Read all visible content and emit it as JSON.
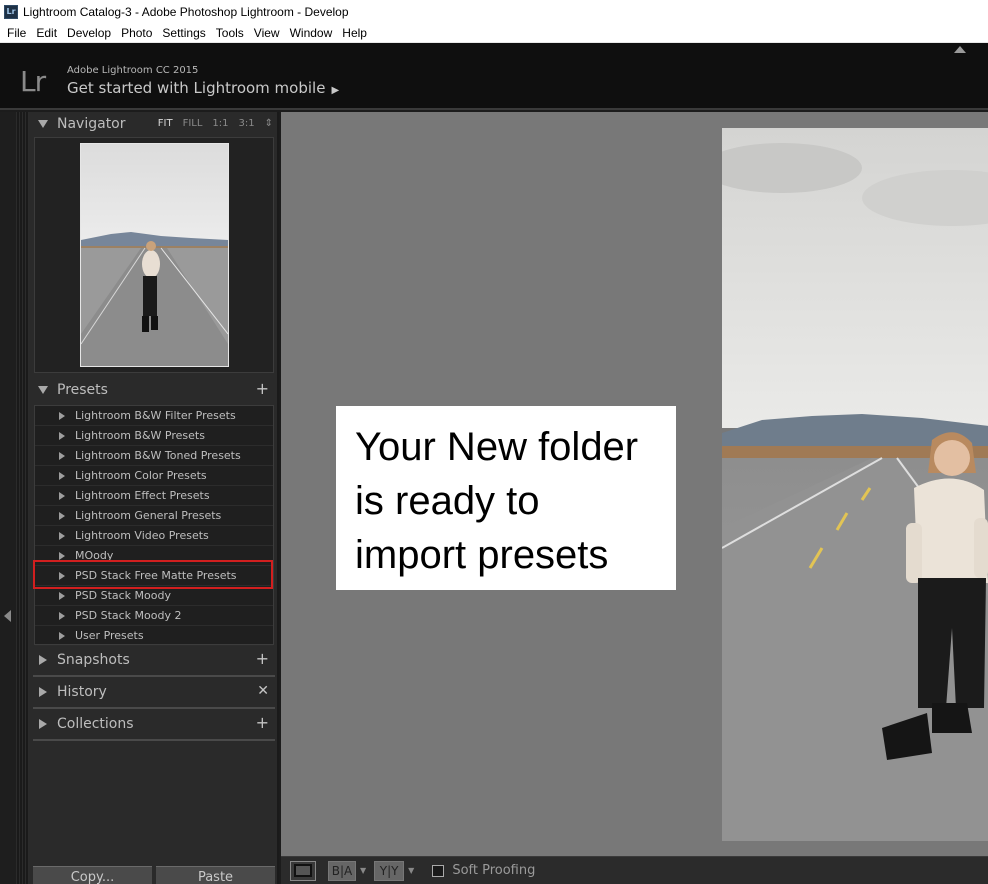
{
  "window": {
    "title": "Lightroom Catalog-3 - Adobe Photoshop Lightroom - Develop",
    "app_icon_text": "Lr"
  },
  "menu": [
    "File",
    "Edit",
    "Develop",
    "Photo",
    "Settings",
    "Tools",
    "View",
    "Window",
    "Help"
  ],
  "identity": {
    "logo": "Lr",
    "product": "Adobe Lightroom CC 2015",
    "cta": "Get started with Lightroom mobile",
    "cta_arrow": "▶"
  },
  "navigator": {
    "title": "Navigator",
    "zoom_options": [
      "FIT",
      "FILL",
      "1:1",
      "3:1"
    ],
    "active_zoom": "FIT"
  },
  "presets": {
    "title": "Presets",
    "items": [
      "Lightroom B&W Filter Presets",
      "Lightroom B&W Presets",
      "Lightroom B&W Toned Presets",
      "Lightroom Color Presets",
      "Lightroom Effect Presets",
      "Lightroom General Presets",
      "Lightroom Video Presets",
      "MOody",
      "PSD Stack Free Matte Presets",
      "PSD Stack Moody",
      "PSD Stack Moody 2",
      "User Presets"
    ],
    "highlighted": "PSD Stack Free Matte Presets"
  },
  "panels": {
    "snapshots": "Snapshots",
    "history": "History",
    "collections": "Collections"
  },
  "buttons": {
    "copy": "Copy...",
    "paste": "Paste"
  },
  "callout": {
    "line1": "Your New folder",
    "line2": "is ready to",
    "line3": "import presets"
  },
  "toolbar": {
    "before_after_label": "B|A",
    "yy_label": "Y|Y",
    "soft_proofing": "Soft Proofing"
  },
  "colors": {
    "highlight_border": "#d21f1f",
    "panel_bg": "#2a2a2a",
    "viewport_bg": "#787878"
  }
}
